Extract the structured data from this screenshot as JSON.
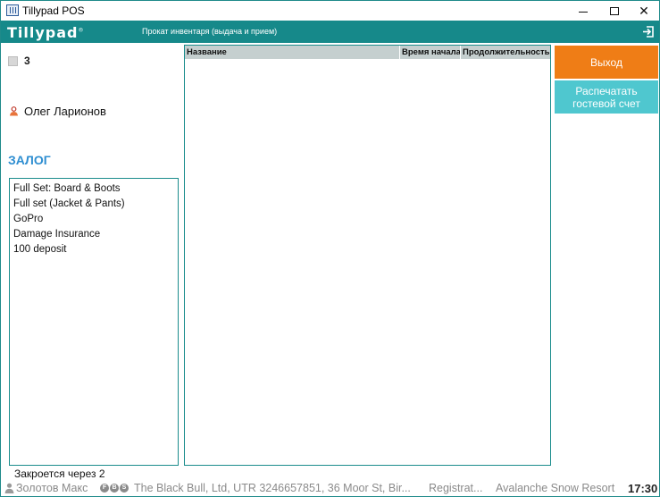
{
  "window": {
    "title": "Tillypad POS"
  },
  "header": {
    "logo": "Tillypad",
    "title": "Прокат инвентаря (выдача и прием)"
  },
  "left_panel": {
    "table_number": "3",
    "waiter_name": "Олег Ларионов",
    "deposit_title": "ЗАЛОГ",
    "deposit_items": [
      "Full Set: Board & Boots",
      "Full set (Jacket & Pants)",
      "GoPro",
      "Damage Insurance",
      "100 deposit"
    ],
    "closes_in": "Закроется через 2"
  },
  "table": {
    "columns": [
      "Название",
      "Время начала",
      "Продолжительность"
    ],
    "rows": []
  },
  "buttons": {
    "exit": "Выход",
    "print_guest_check": "Распечатать гостевой счет"
  },
  "statusbar": {
    "user": "Золотов Макс",
    "badges": [
      "F",
      "B",
      "S"
    ],
    "company": "The Black Bull, Ltd, UTR 3246657851, 36 Moor St, Bir...",
    "registration": "Registrat...",
    "resort": "Avalanche Snow Resort",
    "time": "17:30"
  },
  "colors": {
    "header_teal": "#16898a",
    "exit_orange": "#ef7d16",
    "print_cyan": "#4fc7cf",
    "deposit_blue": "#2e8ed1"
  },
  "icons": {
    "app": "app-icon",
    "logout": "logout-icon",
    "waiter": "person-icon",
    "status_user": "user-icon"
  }
}
